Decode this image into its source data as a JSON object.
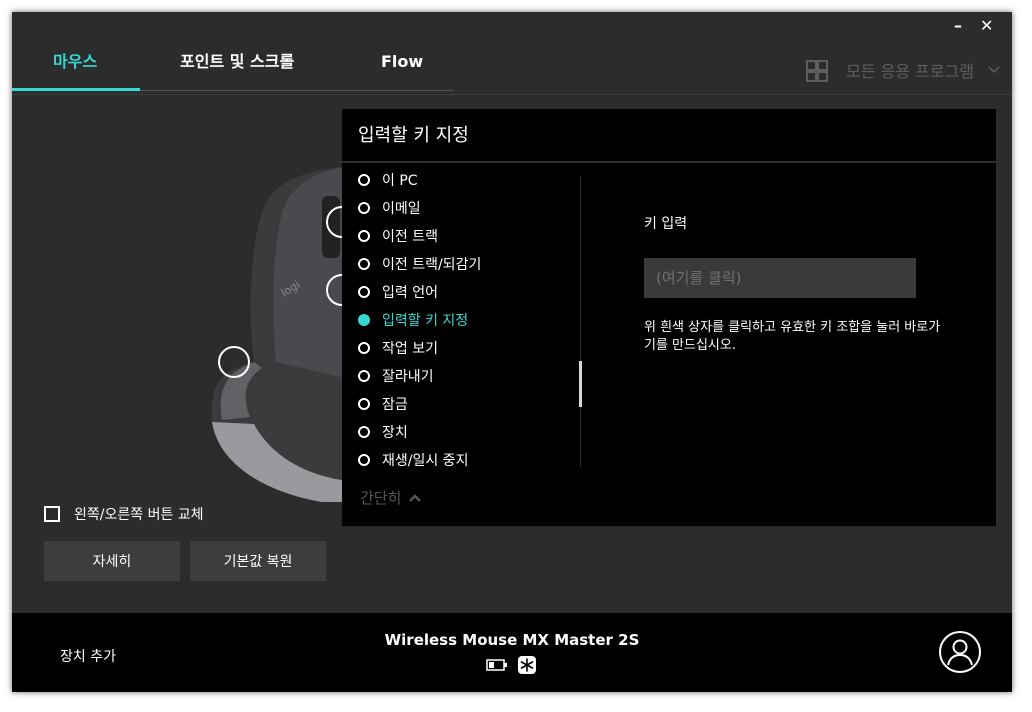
{
  "window": {
    "minimize_glyph": "–",
    "close_glyph": "✕"
  },
  "tabs": [
    {
      "label": "마우스",
      "active": true
    },
    {
      "label": "포인트 및 스크롤",
      "active": false
    },
    {
      "label": "Flow",
      "active": false
    }
  ],
  "app_selector": {
    "label": "모든 응용 프로그램",
    "icon": "grid-icon"
  },
  "left_panel": {
    "swap_buttons_label": "왼쪽/오른쪽 버튼 교체",
    "swap_buttons_checked": false,
    "details_button": "자세히",
    "restore_defaults_button": "기본값 복원"
  },
  "dialog": {
    "title": "입력할 키 지정",
    "options": [
      {
        "label": "이 PC",
        "selected": false
      },
      {
        "label": "이메일",
        "selected": false
      },
      {
        "label": "이전 트랙",
        "selected": false
      },
      {
        "label": "이전 트랙/되감기",
        "selected": false
      },
      {
        "label": "입력 언어",
        "selected": false
      },
      {
        "label": "입력할 키 지정",
        "selected": true
      },
      {
        "label": "작업 보기",
        "selected": false
      },
      {
        "label": "잘라내기",
        "selected": false
      },
      {
        "label": "잠금",
        "selected": false
      },
      {
        "label": "장치",
        "selected": false
      },
      {
        "label": "재생/일시 중지",
        "selected": false
      }
    ],
    "collapse_label": "간단히",
    "key_input_label": "키 입력",
    "key_input_placeholder": "(여기를 클릭)",
    "key_input_help": "위 흰색 상자를 클릭하고 유효한 키 조합을 눌러 바로가기를 만드십시오."
  },
  "footer": {
    "add_device_label": "장치 추가",
    "device_name": "Wireless Mouse MX Master 2S",
    "device_icons": [
      "battery-icon",
      "unifying-receiver-icon"
    ]
  },
  "colors": {
    "accent": "#34d9d2",
    "background": "#2c2c2c",
    "dialog": "#000000"
  }
}
